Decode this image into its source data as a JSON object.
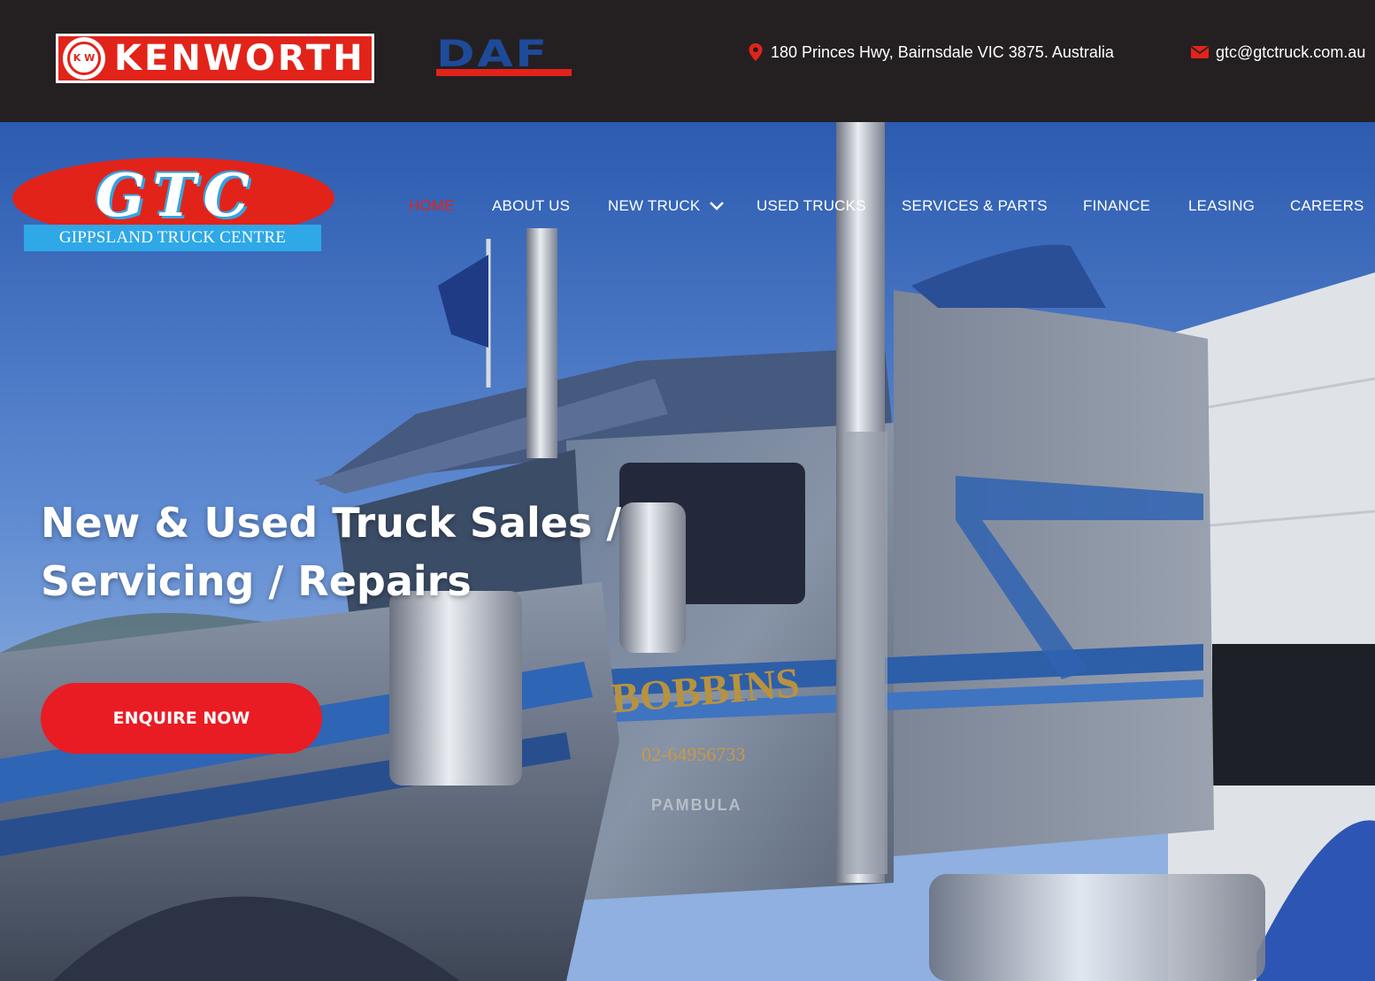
{
  "topbar": {
    "kenworth_logo": {
      "badge": "K W",
      "text": "KENWORTH"
    },
    "daf_logo": {
      "text": "DAF"
    },
    "address": "180 Princes Hwy, Bairnsdale VIC 3875. Australia",
    "email": "gtc@gtctruck.com.au",
    "icons": {
      "address": "map-pin-icon",
      "email": "envelope-icon"
    }
  },
  "logo": {
    "letters": "GTC",
    "name": "GIPPSLAND TRUCK CENTRE"
  },
  "nav": {
    "items": [
      {
        "label": "HOME",
        "active": true
      },
      {
        "label": "ABOUT US"
      },
      {
        "label": "NEW TRUCK",
        "dropdown": true
      },
      {
        "label": "USED TRUCKS"
      },
      {
        "label": "SERVICES & PARTS"
      },
      {
        "label": "FINANCE"
      },
      {
        "label": "LEASING"
      },
      {
        "label": "CAREERS"
      }
    ]
  },
  "hero": {
    "headline_line1": "New & Used Truck Sales /",
    "headline_line2": "Servicing / Repairs",
    "cta_label": "ENQUIRE NOW",
    "truck_door_text": "BOBBINS",
    "truck_phone": "02-64956733",
    "truck_town": "PAMBULA"
  },
  "colors": {
    "brand_red": "#e2231a",
    "cta_red": "#e91c23",
    "topbar_bg": "#242022",
    "gtc_blue": "#2ea8e7",
    "daf_blue": "#1e4a9a"
  }
}
